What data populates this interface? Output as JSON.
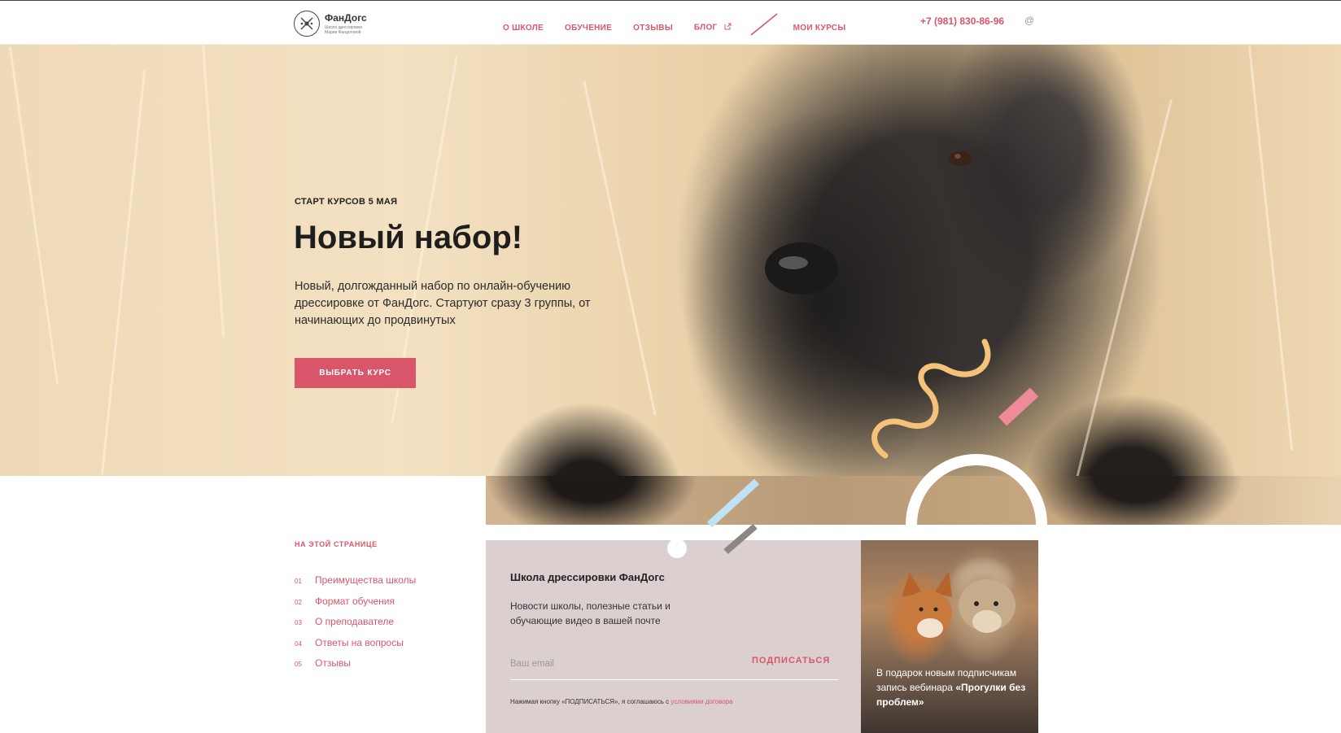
{
  "header": {
    "logo": {
      "name": "ФанДогс",
      "subtitle": "Школа дрессировки Марии Фандоговой"
    },
    "nav": [
      {
        "label": "О школе"
      },
      {
        "label": "Обучение"
      },
      {
        "label": "Отзывы"
      },
      {
        "label": "Блог",
        "icon": "external-link-icon"
      },
      {
        "label": "Мои курсы"
      }
    ],
    "phone": "+7 (981) 830-86-96",
    "email_icon": "@"
  },
  "hero": {
    "kicker": "СТАРТ КУРСОВ 5 МАЯ",
    "title": "Новый набор!",
    "text": "Новый, долгожданный набор по онлайн-обучению дрессировке от ФанДогс. Стартуют сразу 3 группы, от начинающих до продвинутых",
    "button": "ВЫБРАТЬ КУРС"
  },
  "toc": {
    "title": "НА ЭТОЙ СТРАНИЦЕ",
    "items": [
      {
        "num": "01",
        "label": "Преимущества школы"
      },
      {
        "num": "02",
        "label": "Формат обучения"
      },
      {
        "num": "03",
        "label": "О преподавателе"
      },
      {
        "num": "04",
        "label": "Ответы на вопросы"
      },
      {
        "num": "05",
        "label": "Отзывы"
      }
    ]
  },
  "subscribe": {
    "title": "Школа дрессировки ФанДогс",
    "text": "Новости школы, полезные статьи и обучающие видео в вашей почте",
    "placeholder": "Ваш email",
    "button": "ПОДПИСАТЬСЯ",
    "note_prefix": "Нажимая кнопку «ПОДПИСАТЬСЯ», я соглашаюсь с",
    "note_link": "условиями договора"
  },
  "promo": {
    "text": "В подарок новым подписчикам запись вебинара",
    "highlight": "«Прогулки без проблем»"
  },
  "colors": {
    "accent": "#d9566a",
    "subscribe_bg": "#dbcfcf",
    "decor_yellow": "#f5c27a",
    "decor_pink": "#ef8a98",
    "decor_blue": "#bfe3f5",
    "decor_gray": "#8e8585"
  }
}
